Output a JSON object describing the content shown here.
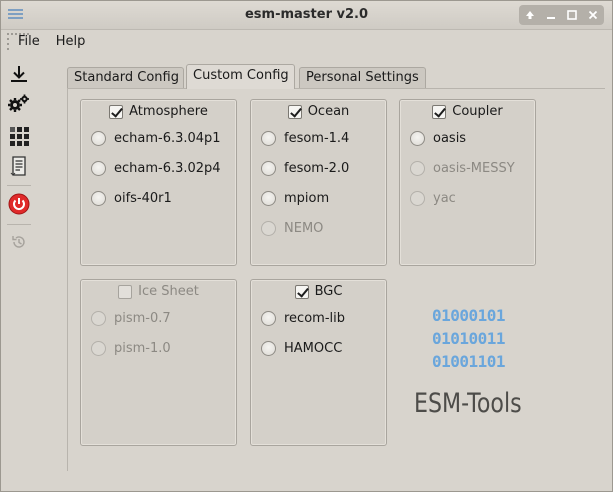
{
  "window": {
    "title": "esm-master v2.0",
    "controls": [
      "up-icon",
      "minimize-icon",
      "maximize-icon",
      "close-icon"
    ]
  },
  "menu": {
    "file": "File",
    "help": "Help"
  },
  "toolbar": [
    "download-icon",
    "gears-icon",
    "grid-icon",
    "document-icon",
    "power-icon",
    "history-icon"
  ],
  "tabs": [
    "Standard Config",
    "Custom Config",
    "Personal Settings"
  ],
  "active_tab": "Custom Config",
  "groups": {
    "atmosphere": {
      "title": "Atmosphere",
      "checked": true,
      "enabled": true,
      "options": [
        {
          "label": "echam-6.3.04p1",
          "enabled": true
        },
        {
          "label": "echam-6.3.02p4",
          "enabled": true
        },
        {
          "label": "oifs-40r1",
          "enabled": true
        }
      ]
    },
    "ocean": {
      "title": "Ocean",
      "checked": true,
      "enabled": true,
      "options": [
        {
          "label": "fesom-1.4",
          "enabled": true
        },
        {
          "label": "fesom-2.0",
          "enabled": true
        },
        {
          "label": "mpiom",
          "enabled": true
        },
        {
          "label": "NEMO",
          "enabled": false
        }
      ]
    },
    "coupler": {
      "title": "Coupler",
      "checked": true,
      "enabled": true,
      "options": [
        {
          "label": "oasis",
          "enabled": true
        },
        {
          "label": "oasis-MESSY",
          "enabled": false
        },
        {
          "label": "yac",
          "enabled": false
        }
      ]
    },
    "ice_sheet": {
      "title": "Ice Sheet",
      "checked": false,
      "enabled": false,
      "options": [
        {
          "label": "pism-0.7",
          "enabled": false
        },
        {
          "label": "pism-1.0",
          "enabled": false
        }
      ]
    },
    "bgc": {
      "title": "BGC",
      "checked": true,
      "enabled": true,
      "options": [
        {
          "label": "recom-lib",
          "enabled": true
        },
        {
          "label": "HAMOCC",
          "enabled": true
        }
      ]
    }
  },
  "logo": {
    "bits": [
      "01000101",
      "01010011",
      "01001101"
    ],
    "text": "ESM-Tools",
    "bits_color": "#6aa6dc"
  }
}
